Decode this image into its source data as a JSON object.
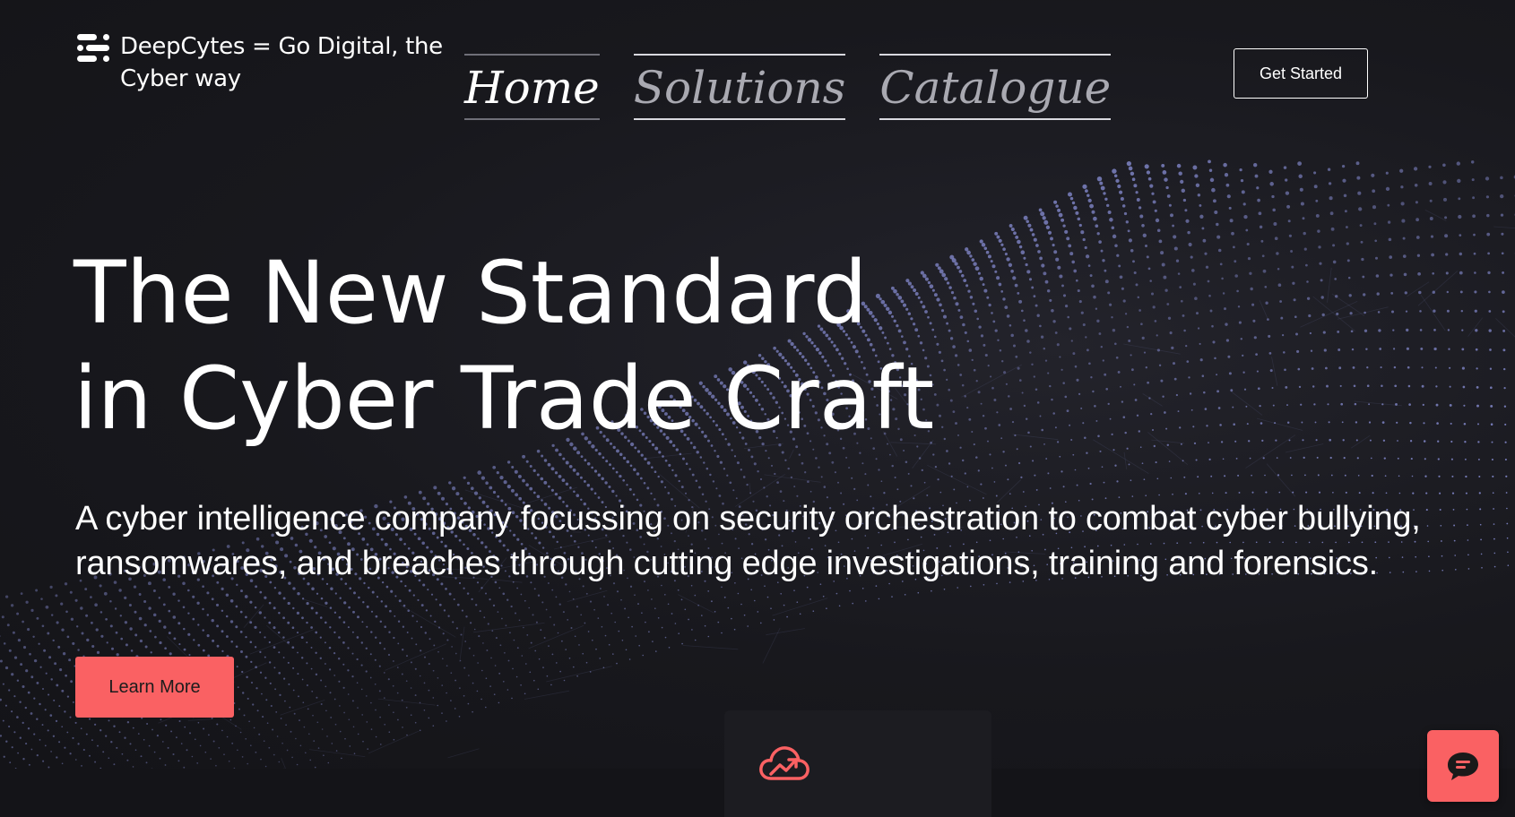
{
  "header": {
    "logo_text": "DeepCytes = Go Digital, the Cyber way",
    "logo_icon": "logo-icon",
    "get_started_label": "Get Started"
  },
  "nav": {
    "items": [
      {
        "label": "Home",
        "active": true
      },
      {
        "label": "Solutions",
        "active": false
      },
      {
        "label": "Catalogue",
        "active": false
      }
    ]
  },
  "hero": {
    "title_line1": "The New Standard",
    "title_line2": "in Cyber Trade Craft",
    "subtitle_line1": "A cyber intelligence company focussing on security orchestration to combat cyber bullying,",
    "subtitle_line2": "ransomwares, and breaches through cutting edge investigations, training and forensics.",
    "learn_more_label": "Learn More"
  },
  "feature_card": {
    "icon": "cloud-growth-icon"
  },
  "chat": {
    "icon": "chat-bubble-icon"
  },
  "colors": {
    "background": "#141418",
    "accent": "#fa6163",
    "text": "#ffffff",
    "nav_inactive": "#a9a9b1",
    "dots": "#8a90d8"
  }
}
